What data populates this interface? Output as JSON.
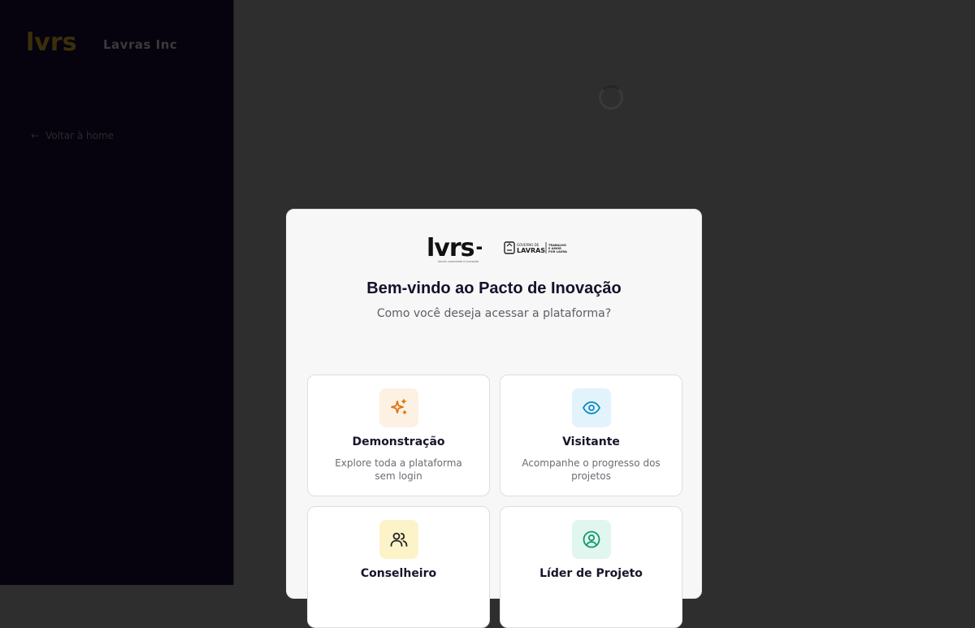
{
  "sidebar": {
    "brand_text": "Lavras Inc",
    "back_link": "Voltar à home"
  },
  "modal": {
    "logo_lvrs": "lvrs+",
    "logo_lvrs_tagline": "lavras conectada à inovação",
    "logo_gov_line1": "GOVERNO DE",
    "logo_gov_line2": "LAVRAS",
    "logo_gov_slogan": "TRABALHO E AMOR POR LAVRAS",
    "title": "Bem-vindo ao Pacto de Inovação",
    "subtitle": "Como você deseja acessar a plataforma?",
    "options": [
      {
        "title": "Demonstração",
        "description": "Explore toda a plataforma sem login",
        "icon": "sparkles-icon",
        "icon_color": "#e0740f",
        "icon_bg": "#fdf1e4"
      },
      {
        "title": "Visitante",
        "description": "Acompanhe o progresso dos projetos",
        "icon": "eye-icon",
        "icon_color": "#0e8ac2",
        "icon_bg": "#e2f3fb"
      },
      {
        "title": "Conselheiro",
        "description": "",
        "icon": "users-icon",
        "icon_color": "#222222",
        "icon_bg": "#fdf3c9"
      },
      {
        "title": "Líder de Projeto",
        "description": "",
        "icon": "user-circle-icon",
        "icon_color": "#0f9a6a",
        "icon_bg": "#e1f6ee"
      }
    ]
  }
}
